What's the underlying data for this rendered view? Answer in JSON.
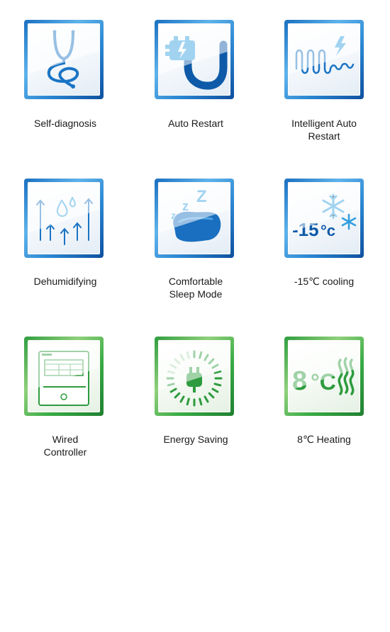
{
  "features": [
    {
      "label": "Self-diagnosis",
      "icon": "stethoscope-icon",
      "theme": "blue"
    },
    {
      "label": "Auto Restart",
      "icon": "plug-restart-icon",
      "theme": "blue"
    },
    {
      "label": "Intelligent Auto\nRestart",
      "icon": "wave-lightning-icon",
      "theme": "blue"
    },
    {
      "label": "Dehumidifying",
      "icon": "droplets-arrows-icon",
      "theme": "blue"
    },
    {
      "label": "Comfortable\nSleep Mode",
      "icon": "pillow-zzz-icon",
      "theme": "blue"
    },
    {
      "label": "-15℃ cooling",
      "icon": "snowflake-minus15-icon",
      "theme": "blue"
    },
    {
      "label": "Wired\nController",
      "icon": "wired-controller-icon",
      "theme": "green"
    },
    {
      "label": "Energy Saving",
      "icon": "plug-ring-icon",
      "theme": "green"
    },
    {
      "label": "8℃ Heating",
      "icon": "heat-8c-icon",
      "theme": "green"
    }
  ],
  "icon_text": {
    "minus15": "-15",
    "celsius": "°c",
    "eight": "8",
    "c_heat": "°C",
    "zzz": [
      "z",
      "z",
      "Z"
    ]
  },
  "colors": {
    "blue_dark": "#0e5aa8",
    "blue_light": "#3fb0e6",
    "green": "#2e9b3e",
    "green_light": "#7fcf6a"
  }
}
